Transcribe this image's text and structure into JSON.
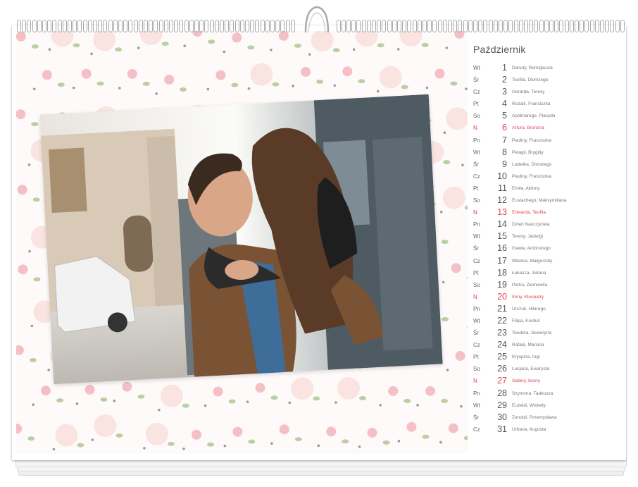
{
  "calendar": {
    "month": "Październik",
    "colors": {
      "holiday": "#e0445a",
      "text": "#555555"
    },
    "days": [
      {
        "wd": "Wt",
        "num": "1",
        "names": "Danuty, Remigiusza",
        "holiday": false
      },
      {
        "wd": "Śr",
        "num": "2",
        "names": "Teofila, Dionizego",
        "holiday": false
      },
      {
        "wd": "Cz",
        "num": "3",
        "names": "Gerarda, Teresy",
        "holiday": false
      },
      {
        "wd": "Pt",
        "num": "4",
        "names": "Rozalii, Franciszka",
        "holiday": false
      },
      {
        "wd": "So",
        "num": "5",
        "names": "Apolinarego, Placyda",
        "holiday": false
      },
      {
        "wd": "N",
        "num": "6",
        "names": "Artura, Brunona",
        "holiday": true
      },
      {
        "wd": "Pn",
        "num": "7",
        "names": "Pauliny, Franciszka",
        "holiday": false
      },
      {
        "wd": "Wt",
        "num": "8",
        "names": "Pelagii, Brygidy",
        "holiday": false
      },
      {
        "wd": "Śr",
        "num": "9",
        "names": "Ludwika, Dionizego",
        "holiday": false
      },
      {
        "wd": "Cz",
        "num": "10",
        "names": "Pauliny, Franciszka",
        "holiday": false
      },
      {
        "wd": "Pt",
        "num": "11",
        "names": "Emila, Aldony",
        "holiday": false
      },
      {
        "wd": "So",
        "num": "12",
        "names": "Eustachego, Maksymiliana",
        "holiday": false
      },
      {
        "wd": "N",
        "num": "13",
        "names": "Edwarda, Teofila",
        "holiday": true
      },
      {
        "wd": "Pn",
        "num": "14",
        "names": "Dzień Nauczyciela",
        "holiday": false
      },
      {
        "wd": "Wt",
        "num": "15",
        "names": "Teresy, Jadwigi",
        "holiday": false
      },
      {
        "wd": "Śr",
        "num": "16",
        "names": "Gawła, Ambrożego",
        "holiday": false
      },
      {
        "wd": "Cz",
        "num": "17",
        "names": "Wiktora, Małgorzaty",
        "holiday": false
      },
      {
        "wd": "Pt",
        "num": "18",
        "names": "Łukasza, Juliana",
        "holiday": false
      },
      {
        "wd": "So",
        "num": "19",
        "names": "Piotra, Ziemowita",
        "holiday": false
      },
      {
        "wd": "N",
        "num": "20",
        "names": "Ireny, Kleopatry",
        "holiday": true
      },
      {
        "wd": "Pn",
        "num": "21",
        "names": "Urszuli, Hilarego",
        "holiday": false
      },
      {
        "wd": "Wt",
        "num": "22",
        "names": "Filipa, Korduli",
        "holiday": false
      },
      {
        "wd": "Śr",
        "num": "23",
        "names": "Teodora, Seweryna",
        "holiday": false
      },
      {
        "wd": "Cz",
        "num": "24",
        "names": "Rafała, Marcina",
        "holiday": false
      },
      {
        "wd": "Pt",
        "num": "25",
        "names": "Kryspina, Ingi",
        "holiday": false
      },
      {
        "wd": "So",
        "num": "26",
        "names": "Lucjana, Ewarysta",
        "holiday": false
      },
      {
        "wd": "N",
        "num": "27",
        "names": "Sabiny, Iwony",
        "holiday": true
      },
      {
        "wd": "Pn",
        "num": "28",
        "names": "Szymona, Tadeusza",
        "holiday": false
      },
      {
        "wd": "Wt",
        "num": "29",
        "names": "Euzebii, Wioletty",
        "holiday": false
      },
      {
        "wd": "Śr",
        "num": "30",
        "names": "Zenobii, Przemysława",
        "holiday": false
      },
      {
        "wd": "Cz",
        "num": "31",
        "names": "Urbana, Augusta",
        "holiday": false
      }
    ]
  },
  "photo": {
    "subject": "couple-piggyback-photo"
  }
}
